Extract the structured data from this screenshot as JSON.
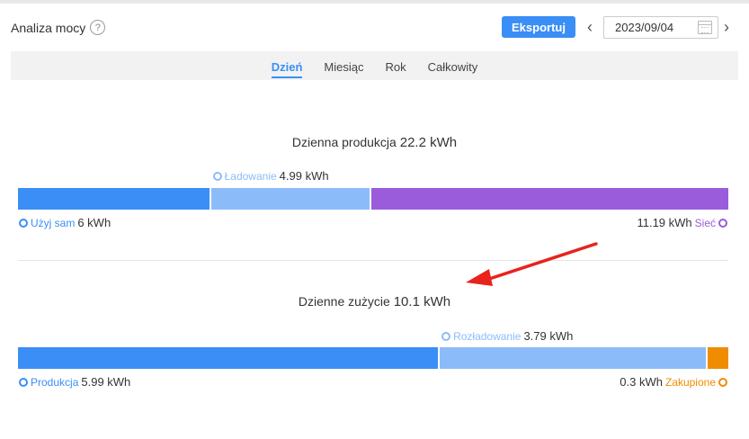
{
  "header": {
    "title": "Analiza mocy",
    "help_icon": "?",
    "export_label": "Eksportuj",
    "date_value": "2023/09/04",
    "prev_icon": "chevron-left-icon",
    "next_icon": "chevron-right-icon"
  },
  "tabs": [
    {
      "label": "Dzień",
      "active": true
    },
    {
      "label": "Miesiąc",
      "active": false
    },
    {
      "label": "Rok",
      "active": false
    },
    {
      "label": "Całkowity",
      "active": false
    }
  ],
  "production": {
    "title_text": "Dzienna produkcja",
    "title_value": "22.2 kWh",
    "segments": [
      {
        "name": "Użyj sam",
        "value": "6 kWh",
        "kwh": 6,
        "color": "#3a8ef6"
      },
      {
        "name": "Ładowanie",
        "value": "4.99 kWh",
        "kwh": 4.99,
        "color": "#8bbcf9"
      },
      {
        "name": "Sieć",
        "value": "11.19 kWh",
        "kwh": 11.19,
        "color": "#9a5cdb"
      }
    ]
  },
  "consumption": {
    "title_text": "Dzienne zużycie",
    "title_value": "10.1 kWh",
    "segments": [
      {
        "name": "Produkcja",
        "value": "5.99 kWh",
        "kwh": 5.99,
        "color": "#3a8ef6"
      },
      {
        "name": "Rozładowanie",
        "value": "3.79 kWh",
        "kwh": 3.79,
        "color": "#8bbcf9"
      },
      {
        "name": "Zakupione",
        "value": "0.3 kWh",
        "kwh": 0.3,
        "color": "#f08c00"
      }
    ]
  },
  "annotation": {
    "arrow_color": "#e8231c"
  }
}
